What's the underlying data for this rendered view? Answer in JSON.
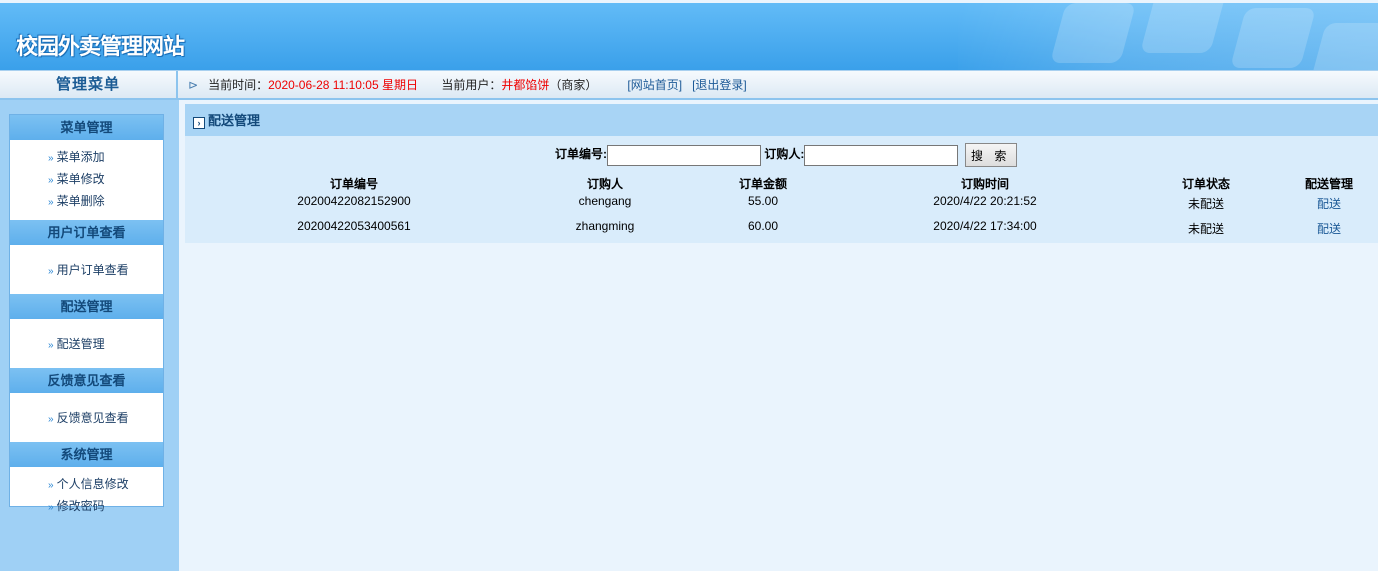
{
  "site": {
    "title": "校园外卖管理网站"
  },
  "topbar": {
    "menu_title": "管理菜单",
    "time_label": "当前时间：",
    "time_value": "2020-06-28 11:10:05 星期日",
    "user_label": "当前用户：",
    "user_name": "井都馅饼",
    "user_role": "（商家）",
    "home_link": "[网站首页]",
    "logout_link": "[退出登录]"
  },
  "sidebar": {
    "groups": [
      {
        "title": "菜单管理",
        "items": [
          "菜单添加",
          "菜单修改",
          "菜单删除"
        ]
      },
      {
        "title": "用户订单查看",
        "items": [
          "用户订单查看"
        ]
      },
      {
        "title": "配送管理",
        "items": [
          "配送管理"
        ]
      },
      {
        "title": "反馈意见查看",
        "items": [
          "反馈意见查看"
        ]
      },
      {
        "title": "系统管理",
        "items": [
          "个人信息修改",
          "修改密码"
        ]
      }
    ]
  },
  "main": {
    "panel_title": "配送管理",
    "search": {
      "order_no_label": "订单编号:",
      "order_no_value": "",
      "buyer_label": "订购人:",
      "buyer_value": "",
      "button": "搜 索"
    },
    "columns": [
      "订单编号",
      "订购人",
      "订单金额",
      "订购时间",
      "订单状态",
      "配送管理"
    ],
    "rows": [
      [
        "20200422082152900",
        "chengang",
        "55.00",
        "2020/4/22 20:21:52",
        "未配送",
        "配送"
      ],
      [
        "20200422053400561",
        "zhangming",
        "60.00",
        "2020/4/22 17:34:00",
        "未配送",
        "配送"
      ]
    ]
  }
}
